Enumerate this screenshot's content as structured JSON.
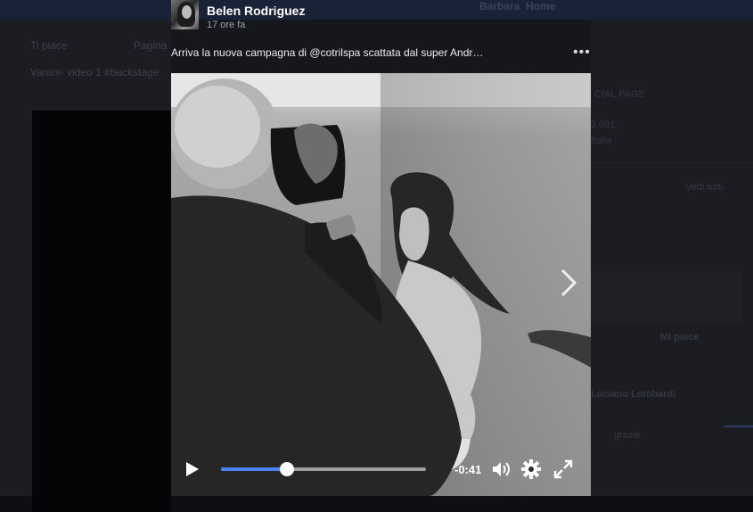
{
  "background": {
    "topbar": {
      "nav_items": [
        "Barbara",
        "Home"
      ]
    },
    "left": {
      "actions": [
        "Ti piace",
        "Pagina"
      ],
      "post_title": "Varani- video 1 #backstage"
    },
    "right": {
      "lines": [
        "CIAL PAGE",
        "2.091",
        "Italia",
        "Vedi tutti",
        "Mi piace",
        "Luciano Lombardi",
        "grazie"
      ]
    }
  },
  "post": {
    "author": "Belen Rodriguez",
    "time": "17 ore fa",
    "caption": "Arriva la nuova campagna di @cotrilspa scattata dal super Andr…",
    "more_label": "•••"
  },
  "video": {
    "description_icon": "video-frame",
    "progress": 0.32,
    "remaining_time": "-0:41",
    "accent_color": "#4c82f7",
    "icons": {
      "play": "play-icon",
      "volume": "volume-icon",
      "settings": "gear-icon",
      "fullscreen": "fullscreen-icon",
      "next": "chevron-right-icon"
    }
  }
}
